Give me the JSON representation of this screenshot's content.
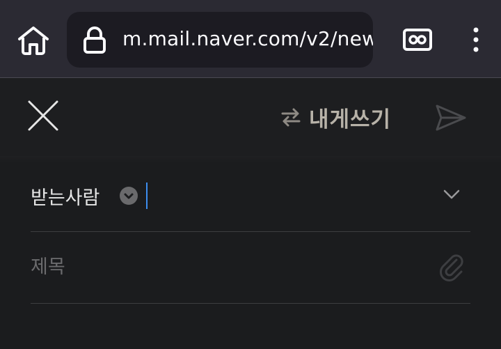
{
  "browser": {
    "url": "m.mail.naver.com/v2/new",
    "icons": {
      "home": "home-icon",
      "lock": "lock-icon",
      "reader": "reader-mode-icon",
      "menu": "more-vert-icon"
    }
  },
  "compose": {
    "title": "내게쓰기",
    "title_icon": "swap-icon",
    "close_icon": "close-icon",
    "send_icon": "send-icon"
  },
  "recipient": {
    "label": "받는사람",
    "toggle_icon": "chevron-down-circle-icon",
    "expand_icon": "chevron-down-icon"
  },
  "subject": {
    "placeholder": "제목",
    "attach_icon": "paperclip-icon"
  },
  "colors": {
    "background": "#1b1c1e",
    "chrome": "#2b2a33",
    "title": "#b7b2a8",
    "caret": "#3d8ef0"
  }
}
